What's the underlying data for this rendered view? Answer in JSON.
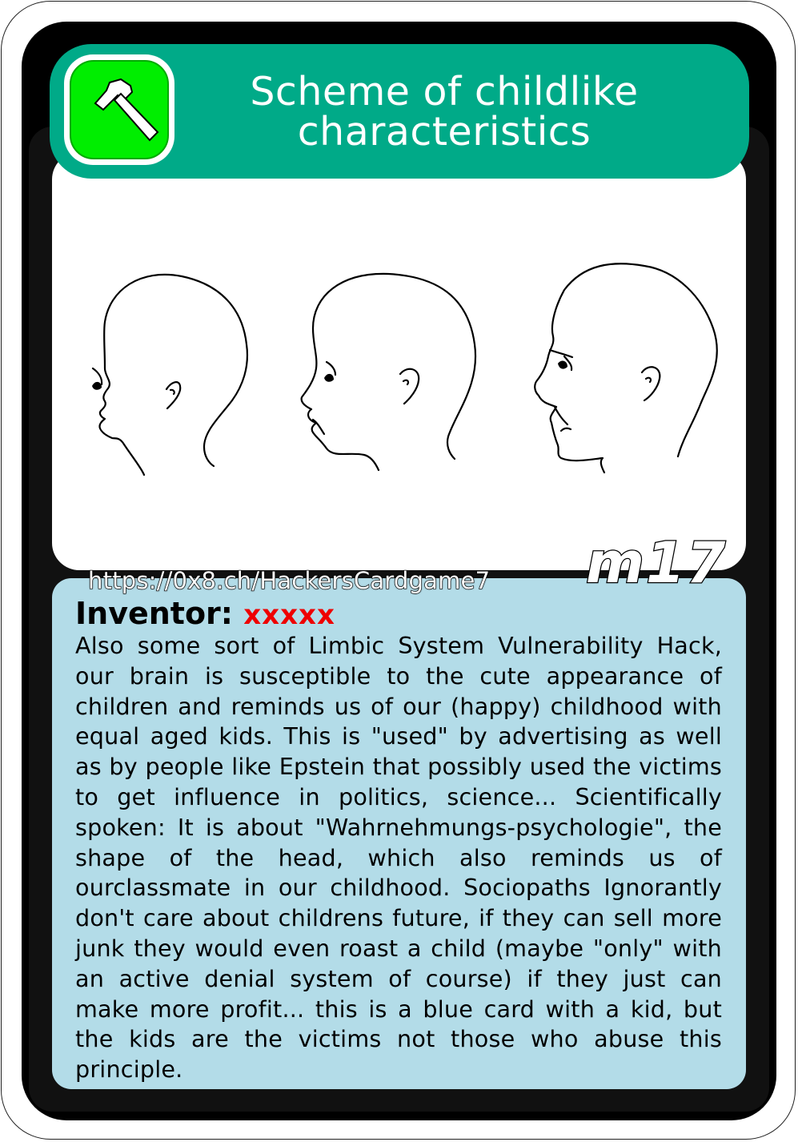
{
  "card": {
    "title": "Scheme of childlike characteristics",
    "icon": "hammer-icon",
    "url": "https://0x8.ch/HackersCardgame7",
    "code": "m17",
    "inventor_label": "Inventor:",
    "inventor_name": "xxxxx",
    "description": "Also some sort of Limbic System Vulnerability Hack, our brain is susceptible to the cute appearance of children and reminds us of our (happy) childhood with equal aged kids. This is \"used\" by advertising as well as by people like Epstein that possibly used the victims to get influence in politics, science... Scientifically spoken: It is about \"Wahrnehmungs-psychologie\", the shape of the head, which also reminds us of ourclassmate in our childhood. Sociopaths Ignorantly don't care about childrens future, if they can sell more junk they would even roast a child (maybe \"only\" with an active denial system of course) if they just can make more profit... this is a blue card with a kid, but the kids are the victims not those who abuse this principle.",
    "colors": {
      "header": "#00aa88",
      "icon_bg": "#00ee00",
      "text_panel": "#b3dce8",
      "frame": "#000000",
      "inventor_name": "#ee0000"
    }
  }
}
